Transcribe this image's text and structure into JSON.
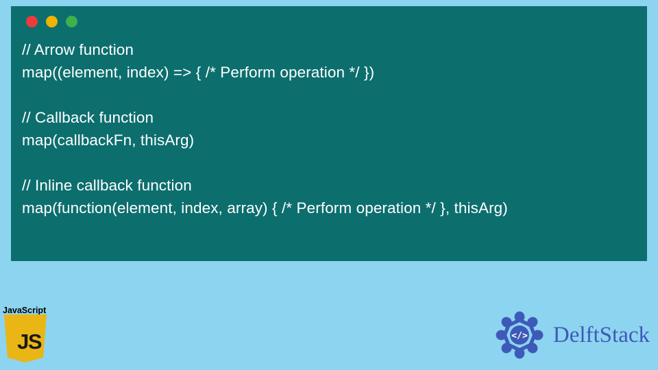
{
  "code": {
    "line1": "// Arrow function",
    "line2": "map((element, index) => { /* Perform operation */ })",
    "line3": "",
    "line4": "// Callback function",
    "line5": "map(callbackFn, thisArg)",
    "line6": "",
    "line7": "// Inline callback function",
    "line8": "map(function(element, index, array) { /* Perform operation */ }, thisArg)"
  },
  "badge": {
    "label": "JavaScript"
  },
  "brand": {
    "name": "DelftStack"
  }
}
